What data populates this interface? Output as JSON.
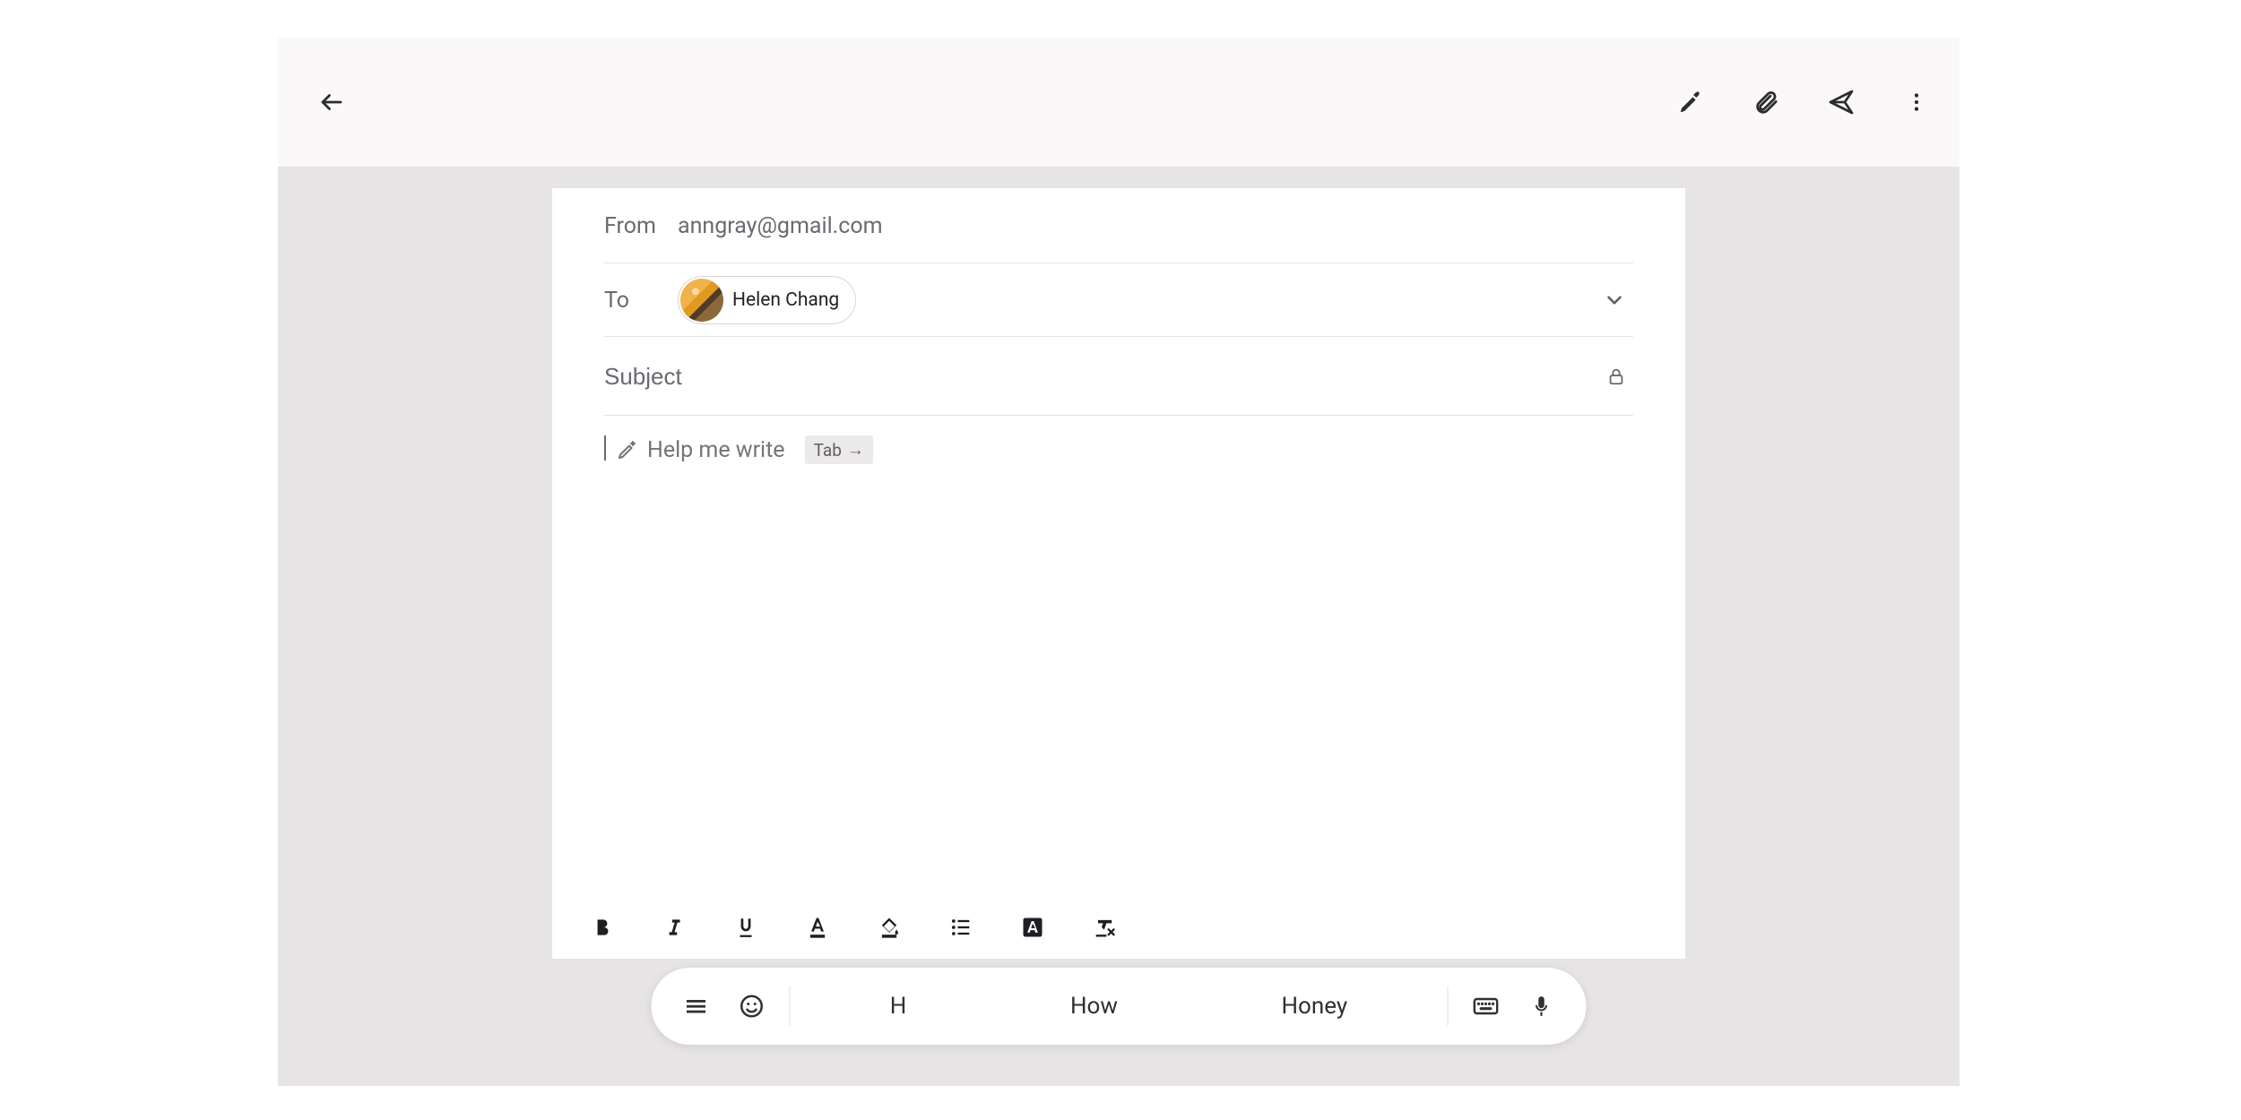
{
  "header": {
    "icons": {
      "back": "back-icon",
      "magic": "magic-pen-icon",
      "attach": "attach-icon",
      "send": "send-icon",
      "more": "more-vert-icon"
    }
  },
  "compose": {
    "from_label": "From",
    "from_value": "anngray@gmail.com",
    "to_label": "To",
    "recipient_name": "Helen Chang",
    "subject_placeholder": "Subject",
    "subject_value": "",
    "help_me_write_label": "Help me write",
    "tab_hint_label": "Tab",
    "tab_hint_arrow": "→"
  },
  "formatting": {
    "tools": [
      "bold",
      "italic",
      "underline",
      "text-color",
      "highlight-color",
      "bulleted-list",
      "font-background",
      "clear-formatting"
    ]
  },
  "keyboard": {
    "suggestions": [
      "H",
      "How",
      "Honey"
    ]
  }
}
